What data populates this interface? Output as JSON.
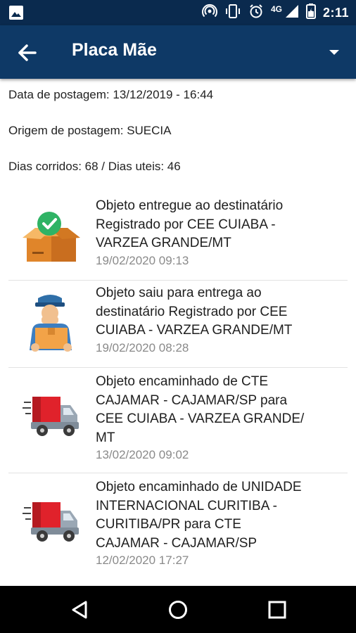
{
  "status_bar": {
    "network": "4G",
    "time": "2:11"
  },
  "app_bar": {
    "title": "Placa Mãe"
  },
  "info": {
    "postage_date": "Data de postagem: 13/12/2019 - 16:44",
    "postage_origin": "Origem de postagem: SUECIA",
    "days": "Dias corridos: 68 / Dias uteis: 46"
  },
  "events": [
    {
      "icon": "delivered-box-icon",
      "lines": [
        "Objeto entregue ao destinatário",
        "Registrado por CEE CUIABA -",
        "VARZEA GRANDE/MT"
      ],
      "date": "19/02/2020 09:13"
    },
    {
      "icon": "courier-icon",
      "lines": [
        "Objeto saiu para entrega ao",
        "destinatário Registrado por CEE",
        "CUIABA - VARZEA GRANDE/MT"
      ],
      "date": "19/02/2020 08:28"
    },
    {
      "icon": "truck-icon",
      "lines": [
        "Objeto encaminhado de CTE",
        "CAJAMAR - CAJAMAR/SP para",
        "CEE CUIABA - VARZEA GRANDE/",
        "MT"
      ],
      "date": "13/02/2020 09:02"
    },
    {
      "icon": "truck-icon",
      "lines": [
        "Objeto encaminhado de UNIDADE",
        "INTERNACIONAL CURITIBA -",
        "CURITIBA/PR para CTE",
        "CAJAMAR - CAJAMAR/SP"
      ],
      "date": "12/02/2020 17:27"
    }
  ]
}
